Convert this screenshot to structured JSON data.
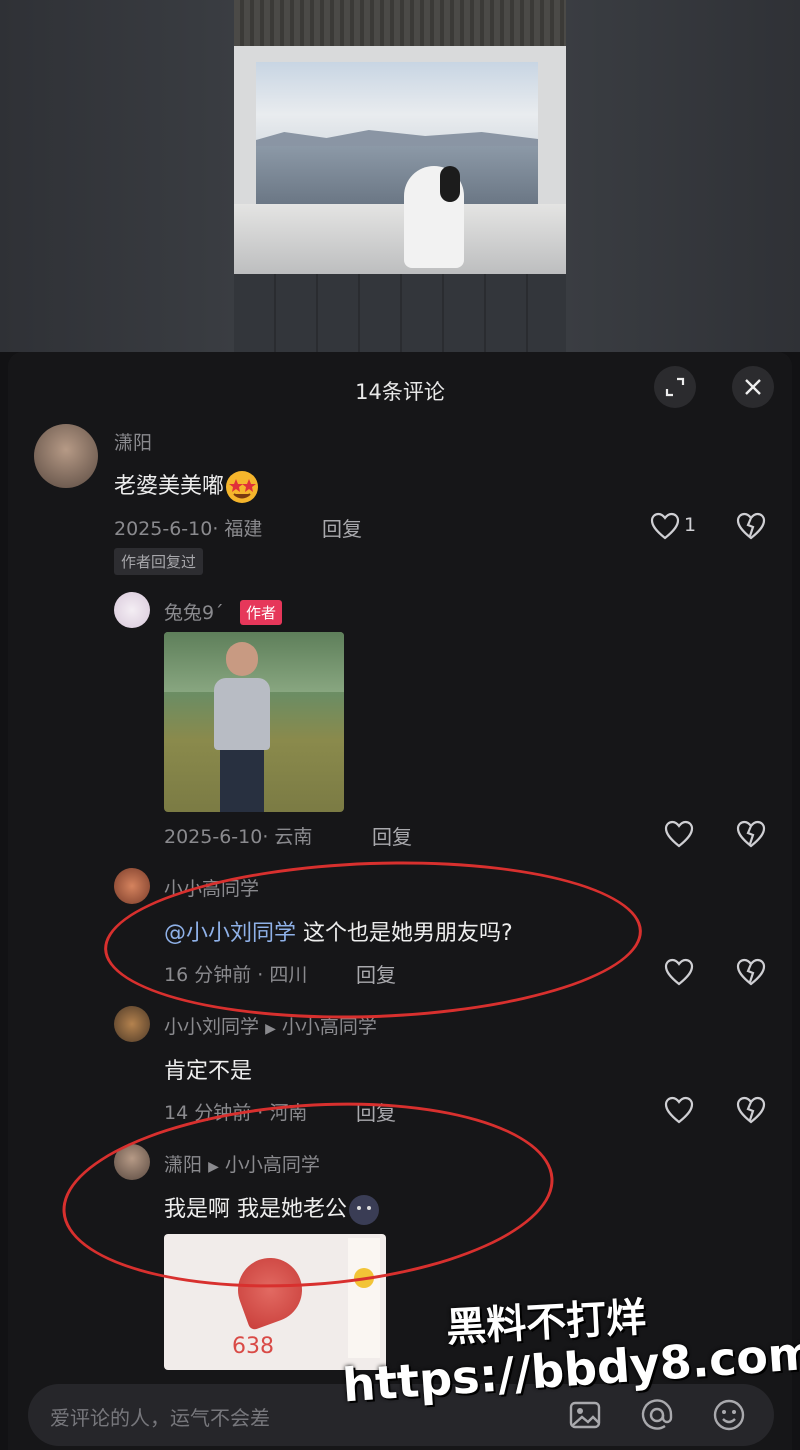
{
  "header": {
    "title": "14条评论",
    "expand_icon": "expand-icon",
    "close_icon": "close-icon"
  },
  "comments": [
    {
      "user": "潇阳",
      "text": "老婆美美嘟",
      "emoji": "star-eyes-emoji",
      "meta": "2025-6-10· 福建",
      "reply_label": "回复",
      "likes": "1",
      "badge": "作者回复过"
    },
    {
      "user": "兔兔9ˊ",
      "author_badge": "作者",
      "meta": "2025-6-10· 云南",
      "reply_label": "回复",
      "image": "man-in-field-photo"
    },
    {
      "user": "小小高同学",
      "mention": "@小小刘同学",
      "text": "这个也是她男朋友吗?",
      "meta": "16 分钟前 · 四川",
      "reply_label": "回复"
    },
    {
      "user": "小小刘同学",
      "reply_to": "小小高同学",
      "text": "肯定不是",
      "meta": "14 分钟前 · 河南",
      "reply_label": "回复"
    },
    {
      "user": "潇阳",
      "reply_to": "小小高同学",
      "text": "我是啊 我是她老公",
      "emoji": "blush-face-emoji",
      "image_number": "638"
    }
  ],
  "input": {
    "placeholder": "爱评论的人，运气不会差",
    "icons": [
      "image-icon",
      "at-icon",
      "emoji-icon"
    ]
  },
  "watermark": {
    "line1": "黑料不打烊",
    "line2": "https://bbdy8.com"
  },
  "colors": {
    "accent": "#e6375a",
    "mention": "#8fb1e8",
    "annotation": "#d8302e"
  }
}
